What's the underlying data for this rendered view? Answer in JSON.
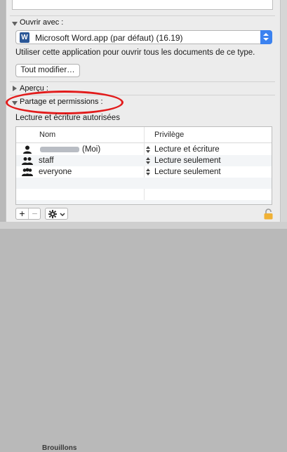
{
  "open_with": {
    "section_label": "Ouvrir avec :",
    "app_selected": "Microsoft Word.app (par défaut) (16.19)",
    "app_icon": "word-icon",
    "description": "Utiliser cette application pour ouvrir tous les documents de ce type.",
    "change_all_button": "Tout modifier…"
  },
  "preview": {
    "section_label": "Aperçu :"
  },
  "sharing": {
    "section_label": "Partage et permissions :",
    "description": "Lecture et écriture autorisées",
    "columns": {
      "name": "Nom",
      "privilege": "Privilège"
    },
    "rows": [
      {
        "name": "(Moi)",
        "privilege": "Lecture et écriture",
        "icon": "single-user-icon"
      },
      {
        "name": "staff",
        "privilege": "Lecture seulement",
        "icon": "group-icon"
      },
      {
        "name": "everyone",
        "privilege": "Lecture seulement",
        "icon": "everyone-group-icon"
      }
    ]
  },
  "toolbar": {
    "add": "+",
    "remove": "−"
  },
  "background": {
    "partial_text": "Brouillons"
  },
  "colors": {
    "highlight": "#e21b1b",
    "popup_accent": "#3b82f0"
  }
}
